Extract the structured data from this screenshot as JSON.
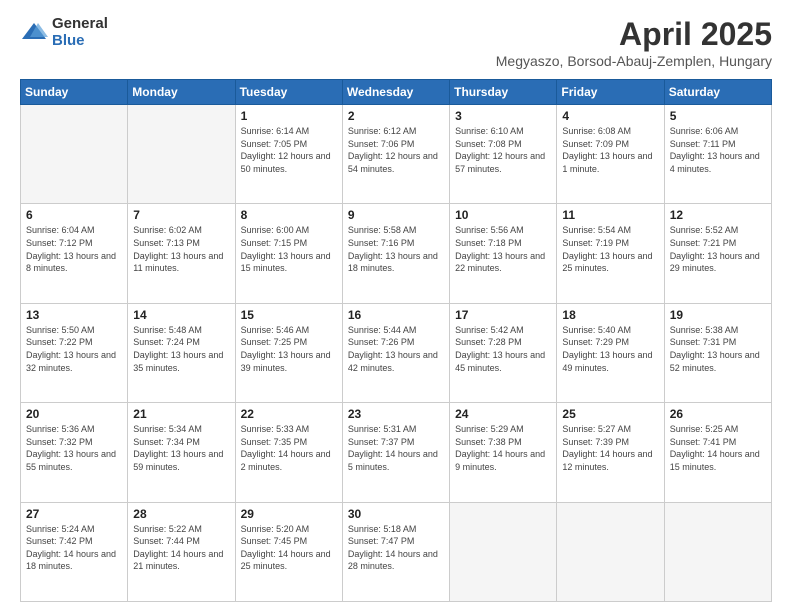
{
  "logo": {
    "general": "General",
    "blue": "Blue"
  },
  "title": "April 2025",
  "subtitle": "Megyaszo, Borsod-Abauj-Zemplen, Hungary",
  "headers": [
    "Sunday",
    "Monday",
    "Tuesday",
    "Wednesday",
    "Thursday",
    "Friday",
    "Saturday"
  ],
  "weeks": [
    [
      {
        "day": "",
        "info": ""
      },
      {
        "day": "",
        "info": ""
      },
      {
        "day": "1",
        "info": "Sunrise: 6:14 AM\nSunset: 7:05 PM\nDaylight: 12 hours and 50 minutes."
      },
      {
        "day": "2",
        "info": "Sunrise: 6:12 AM\nSunset: 7:06 PM\nDaylight: 12 hours and 54 minutes."
      },
      {
        "day": "3",
        "info": "Sunrise: 6:10 AM\nSunset: 7:08 PM\nDaylight: 12 hours and 57 minutes."
      },
      {
        "day": "4",
        "info": "Sunrise: 6:08 AM\nSunset: 7:09 PM\nDaylight: 13 hours and 1 minute."
      },
      {
        "day": "5",
        "info": "Sunrise: 6:06 AM\nSunset: 7:11 PM\nDaylight: 13 hours and 4 minutes."
      }
    ],
    [
      {
        "day": "6",
        "info": "Sunrise: 6:04 AM\nSunset: 7:12 PM\nDaylight: 13 hours and 8 minutes."
      },
      {
        "day": "7",
        "info": "Sunrise: 6:02 AM\nSunset: 7:13 PM\nDaylight: 13 hours and 11 minutes."
      },
      {
        "day": "8",
        "info": "Sunrise: 6:00 AM\nSunset: 7:15 PM\nDaylight: 13 hours and 15 minutes."
      },
      {
        "day": "9",
        "info": "Sunrise: 5:58 AM\nSunset: 7:16 PM\nDaylight: 13 hours and 18 minutes."
      },
      {
        "day": "10",
        "info": "Sunrise: 5:56 AM\nSunset: 7:18 PM\nDaylight: 13 hours and 22 minutes."
      },
      {
        "day": "11",
        "info": "Sunrise: 5:54 AM\nSunset: 7:19 PM\nDaylight: 13 hours and 25 minutes."
      },
      {
        "day": "12",
        "info": "Sunrise: 5:52 AM\nSunset: 7:21 PM\nDaylight: 13 hours and 29 minutes."
      }
    ],
    [
      {
        "day": "13",
        "info": "Sunrise: 5:50 AM\nSunset: 7:22 PM\nDaylight: 13 hours and 32 minutes."
      },
      {
        "day": "14",
        "info": "Sunrise: 5:48 AM\nSunset: 7:24 PM\nDaylight: 13 hours and 35 minutes."
      },
      {
        "day": "15",
        "info": "Sunrise: 5:46 AM\nSunset: 7:25 PM\nDaylight: 13 hours and 39 minutes."
      },
      {
        "day": "16",
        "info": "Sunrise: 5:44 AM\nSunset: 7:26 PM\nDaylight: 13 hours and 42 minutes."
      },
      {
        "day": "17",
        "info": "Sunrise: 5:42 AM\nSunset: 7:28 PM\nDaylight: 13 hours and 45 minutes."
      },
      {
        "day": "18",
        "info": "Sunrise: 5:40 AM\nSunset: 7:29 PM\nDaylight: 13 hours and 49 minutes."
      },
      {
        "day": "19",
        "info": "Sunrise: 5:38 AM\nSunset: 7:31 PM\nDaylight: 13 hours and 52 minutes."
      }
    ],
    [
      {
        "day": "20",
        "info": "Sunrise: 5:36 AM\nSunset: 7:32 PM\nDaylight: 13 hours and 55 minutes."
      },
      {
        "day": "21",
        "info": "Sunrise: 5:34 AM\nSunset: 7:34 PM\nDaylight: 13 hours and 59 minutes."
      },
      {
        "day": "22",
        "info": "Sunrise: 5:33 AM\nSunset: 7:35 PM\nDaylight: 14 hours and 2 minutes."
      },
      {
        "day": "23",
        "info": "Sunrise: 5:31 AM\nSunset: 7:37 PM\nDaylight: 14 hours and 5 minutes."
      },
      {
        "day": "24",
        "info": "Sunrise: 5:29 AM\nSunset: 7:38 PM\nDaylight: 14 hours and 9 minutes."
      },
      {
        "day": "25",
        "info": "Sunrise: 5:27 AM\nSunset: 7:39 PM\nDaylight: 14 hours and 12 minutes."
      },
      {
        "day": "26",
        "info": "Sunrise: 5:25 AM\nSunset: 7:41 PM\nDaylight: 14 hours and 15 minutes."
      }
    ],
    [
      {
        "day": "27",
        "info": "Sunrise: 5:24 AM\nSunset: 7:42 PM\nDaylight: 14 hours and 18 minutes."
      },
      {
        "day": "28",
        "info": "Sunrise: 5:22 AM\nSunset: 7:44 PM\nDaylight: 14 hours and 21 minutes."
      },
      {
        "day": "29",
        "info": "Sunrise: 5:20 AM\nSunset: 7:45 PM\nDaylight: 14 hours and 25 minutes."
      },
      {
        "day": "30",
        "info": "Sunrise: 5:18 AM\nSunset: 7:47 PM\nDaylight: 14 hours and 28 minutes."
      },
      {
        "day": "",
        "info": ""
      },
      {
        "day": "",
        "info": ""
      },
      {
        "day": "",
        "info": ""
      }
    ]
  ]
}
